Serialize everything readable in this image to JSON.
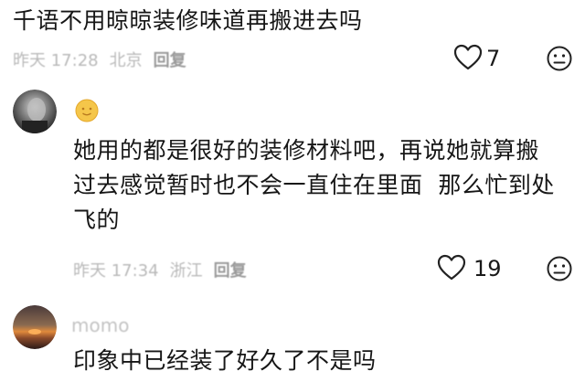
{
  "comments": [
    {
      "text": "千语不用晾晾装修味道再搬进去吗",
      "date": "昨天 17:28",
      "location": "北京",
      "reply_label": "回复",
      "likes": "7",
      "icons": {
        "like": "heart-icon",
        "dislike": "neutral-face-icon"
      }
    },
    {
      "username": "",
      "text_lines": [
        "她用的都是很好的装修材料吧，再说她就算搬",
        "过去感觉暂时也不会一直住在里面  那么忙到处",
        "飞的"
      ],
      "date": "昨天 17:34",
      "location": "浙江",
      "reply_label": "回复",
      "likes": "19",
      "icons": {
        "like": "heart-icon",
        "dislike": "neutral-face-icon"
      }
    },
    {
      "username": "momo",
      "text": "印象中已经装了好久了不是吗"
    }
  ],
  "colors": {
    "meta": "#b9b9b9",
    "text": "#161616",
    "badge": "#f5c64a"
  }
}
